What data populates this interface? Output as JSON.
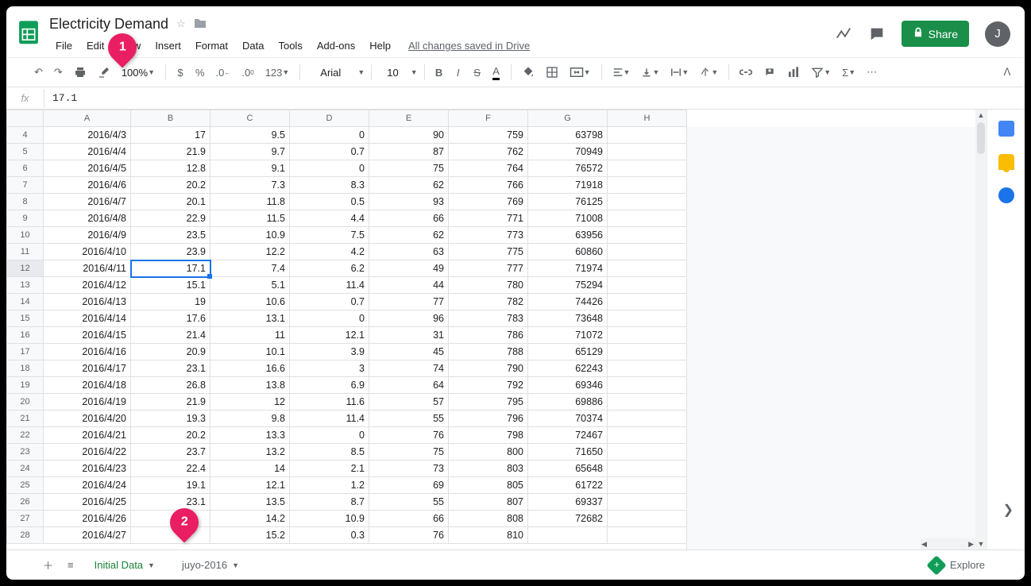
{
  "doc_title": "Electricity Demand",
  "menubar": [
    "File",
    "Edit",
    "View",
    "Insert",
    "Format",
    "Data",
    "Tools",
    "Add-ons",
    "Help"
  ],
  "saved_msg": "All changes saved in Drive",
  "share_label": "Share",
  "avatar_initial": "J",
  "toolbar": {
    "zoom": "100%",
    "font": "Arial",
    "size": "10"
  },
  "fx_value": "17.1",
  "columns": [
    "A",
    "B",
    "C",
    "D",
    "E",
    "F",
    "G",
    "H"
  ],
  "selected_cell": {
    "row": 12,
    "col": "B"
  },
  "rows": [
    {
      "n": 4,
      "A": "2016/4/3",
      "B": "17",
      "C": "9.5",
      "D": "0",
      "E": "90",
      "F": "759",
      "G": "63798"
    },
    {
      "n": 5,
      "A": "2016/4/4",
      "B": "21.9",
      "C": "9.7",
      "D": "0.7",
      "E": "87",
      "F": "762",
      "G": "70949"
    },
    {
      "n": 6,
      "A": "2016/4/5",
      "B": "12.8",
      "C": "9.1",
      "D": "0",
      "E": "75",
      "F": "764",
      "G": "76572"
    },
    {
      "n": 7,
      "A": "2016/4/6",
      "B": "20.2",
      "C": "7.3",
      "D": "8.3",
      "E": "62",
      "F": "766",
      "G": "71918"
    },
    {
      "n": 8,
      "A": "2016/4/7",
      "B": "20.1",
      "C": "11.8",
      "D": "0.5",
      "E": "93",
      "F": "769",
      "G": "76125"
    },
    {
      "n": 9,
      "A": "2016/4/8",
      "B": "22.9",
      "C": "11.5",
      "D": "4.4",
      "E": "66",
      "F": "771",
      "G": "71008"
    },
    {
      "n": 10,
      "A": "2016/4/9",
      "B": "23.5",
      "C": "10.9",
      "D": "7.5",
      "E": "62",
      "F": "773",
      "G": "63956"
    },
    {
      "n": 11,
      "A": "2016/4/10",
      "B": "23.9",
      "C": "12.2",
      "D": "4.2",
      "E": "63",
      "F": "775",
      "G": "60860"
    },
    {
      "n": 12,
      "A": "2016/4/11",
      "B": "17.1",
      "C": "7.4",
      "D": "6.2",
      "E": "49",
      "F": "777",
      "G": "71974"
    },
    {
      "n": 13,
      "A": "2016/4/12",
      "B": "15.1",
      "C": "5.1",
      "D": "11.4",
      "E": "44",
      "F": "780",
      "G": "75294"
    },
    {
      "n": 14,
      "A": "2016/4/13",
      "B": "19",
      "C": "10.6",
      "D": "0.7",
      "E": "77",
      "F": "782",
      "G": "74426"
    },
    {
      "n": 15,
      "A": "2016/4/14",
      "B": "17.6",
      "C": "13.1",
      "D": "0",
      "E": "96",
      "F": "783",
      "G": "73648"
    },
    {
      "n": 16,
      "A": "2016/4/15",
      "B": "21.4",
      "C": "11",
      "D": "12.1",
      "E": "31",
      "F": "786",
      "G": "71072"
    },
    {
      "n": 17,
      "A": "2016/4/16",
      "B": "20.9",
      "C": "10.1",
      "D": "3.9",
      "E": "45",
      "F": "788",
      "G": "65129"
    },
    {
      "n": 18,
      "A": "2016/4/17",
      "B": "23.1",
      "C": "16.6",
      "D": "3",
      "E": "74",
      "F": "790",
      "G": "62243"
    },
    {
      "n": 19,
      "A": "2016/4/18",
      "B": "26.8",
      "C": "13.8",
      "D": "6.9",
      "E": "64",
      "F": "792",
      "G": "69346"
    },
    {
      "n": 20,
      "A": "2016/4/19",
      "B": "21.9",
      "C": "12",
      "D": "11.6",
      "E": "57",
      "F": "795",
      "G": "69886"
    },
    {
      "n": 21,
      "A": "2016/4/20",
      "B": "19.3",
      "C": "9.8",
      "D": "11.4",
      "E": "55",
      "F": "796",
      "G": "70374"
    },
    {
      "n": 22,
      "A": "2016/4/21",
      "B": "20.2",
      "C": "13.3",
      "D": "0",
      "E": "76",
      "F": "798",
      "G": "72467"
    },
    {
      "n": 23,
      "A": "2016/4/22",
      "B": "23.7",
      "C": "13.2",
      "D": "8.5",
      "E": "75",
      "F": "800",
      "G": "71650"
    },
    {
      "n": 24,
      "A": "2016/4/23",
      "B": "22.4",
      "C": "14",
      "D": "2.1",
      "E": "73",
      "F": "803",
      "G": "65648"
    },
    {
      "n": 25,
      "A": "2016/4/24",
      "B": "19.1",
      "C": "12.1",
      "D": "1.2",
      "E": "69",
      "F": "805",
      "G": "61722"
    },
    {
      "n": 26,
      "A": "2016/4/25",
      "B": "23.1",
      "C": "13.5",
      "D": "8.7",
      "E": "55",
      "F": "807",
      "G": "69337"
    },
    {
      "n": 27,
      "A": "2016/4/26",
      "B": "",
      "C": "14.2",
      "D": "10.9",
      "E": "66",
      "F": "808",
      "G": "72682"
    },
    {
      "n": 28,
      "A": "2016/4/27",
      "B": "",
      "C": "15.2",
      "D": "0.3",
      "E": "76",
      "F": "810",
      "G": ""
    }
  ],
  "tabs": {
    "active": "Initial Data",
    "other": "juyo-2016"
  },
  "explore_label": "Explore",
  "annotations": {
    "a1": "1",
    "a2": "2"
  }
}
